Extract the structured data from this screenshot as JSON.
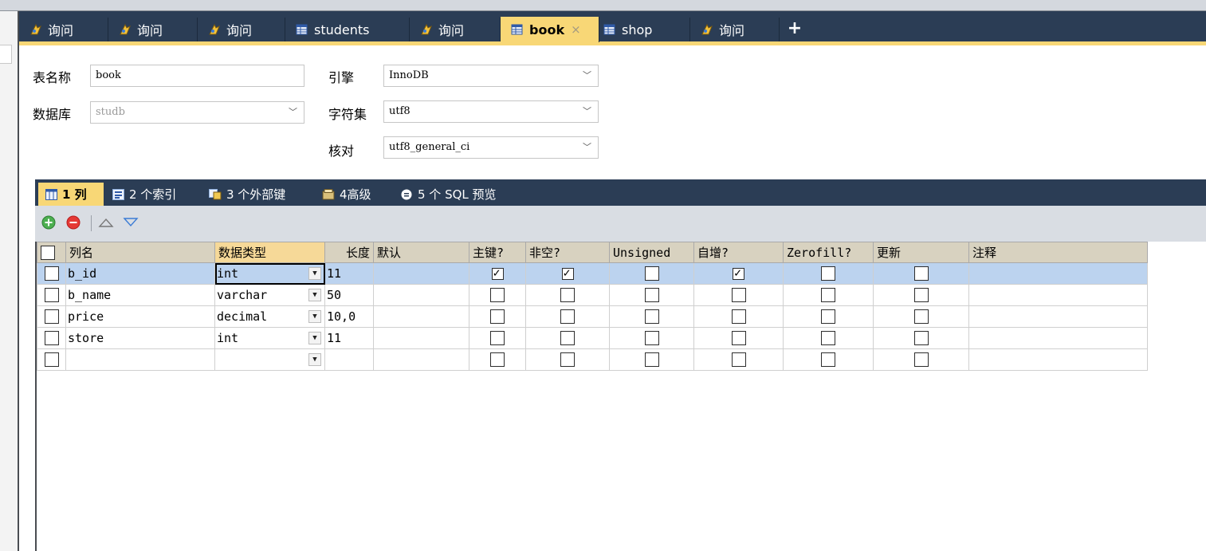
{
  "tabs": [
    {
      "label": "询问",
      "icon": "query-icon",
      "active": false
    },
    {
      "label": "询问",
      "icon": "query-icon",
      "active": false
    },
    {
      "label": "询问",
      "icon": "query-icon",
      "active": false
    },
    {
      "label": "students",
      "icon": "table-icon",
      "active": false
    },
    {
      "label": "询问",
      "icon": "query-icon",
      "active": false
    },
    {
      "label": "book",
      "icon": "table-icon",
      "active": true
    },
    {
      "label": "shop",
      "icon": "table-icon",
      "active": false
    },
    {
      "label": "询问",
      "icon": "query-icon",
      "active": false
    }
  ],
  "tab_close_glyph": "×",
  "tab_add_glyph": "+",
  "form": {
    "table_name_label": "表名称",
    "table_name_value": "book",
    "database_label": "数据库",
    "database_value": "studb",
    "engine_label": "引擎",
    "engine_value": "InnoDB",
    "charset_label": "字符集",
    "charset_value": "utf8",
    "collation_label": "核对",
    "collation_value": "utf8_general_ci"
  },
  "subtabs": [
    {
      "label": "1 列",
      "icon": "columns-icon",
      "active": true
    },
    {
      "label": "2 个索引",
      "icon": "index-icon",
      "active": false
    },
    {
      "label": "3 个外部键",
      "icon": "foreign-key-icon",
      "active": false
    },
    {
      "label": "4高级",
      "icon": "advanced-icon",
      "active": false
    },
    {
      "label": "5 个 SQL 预览",
      "icon": "sql-preview-icon",
      "active": false
    }
  ],
  "grid": {
    "headers": [
      "列名",
      "数据类型",
      "长度",
      "默认",
      "主键?",
      "非空?",
      "Unsigned",
      "自增?",
      "Zerofill?",
      "更新",
      "注释"
    ],
    "rows": [
      {
        "name": "b_id",
        "type": "int",
        "length": "11",
        "default": "",
        "pk": true,
        "notnull": true,
        "unsigned": false,
        "autoinc": true,
        "zerofill": false,
        "update": false,
        "comment": "",
        "selected": true
      },
      {
        "name": "b_name",
        "type": "varchar",
        "length": "50",
        "default": "",
        "pk": false,
        "notnull": false,
        "unsigned": false,
        "autoinc": false,
        "zerofill": false,
        "update": false,
        "comment": "",
        "selected": false
      },
      {
        "name": "price",
        "type": "decimal",
        "length": "10,0",
        "default": "",
        "pk": false,
        "notnull": false,
        "unsigned": false,
        "autoinc": false,
        "zerofill": false,
        "update": false,
        "comment": "",
        "selected": false
      },
      {
        "name": "store",
        "type": "int",
        "length": "11",
        "default": "",
        "pk": false,
        "notnull": false,
        "unsigned": false,
        "autoinc": false,
        "zerofill": false,
        "update": false,
        "comment": "",
        "selected": false
      },
      {
        "name": "",
        "type": "",
        "length": "",
        "default": "",
        "pk": false,
        "notnull": false,
        "unsigned": false,
        "autoinc": false,
        "zerofill": false,
        "update": false,
        "comment": "",
        "selected": false
      }
    ]
  },
  "colors": {
    "tabbar_bg": "#2b3d55",
    "active_tab_bg": "#f8d776",
    "selected_row_bg": "#bcd3ef",
    "header_bg": "#d8d2c0"
  }
}
